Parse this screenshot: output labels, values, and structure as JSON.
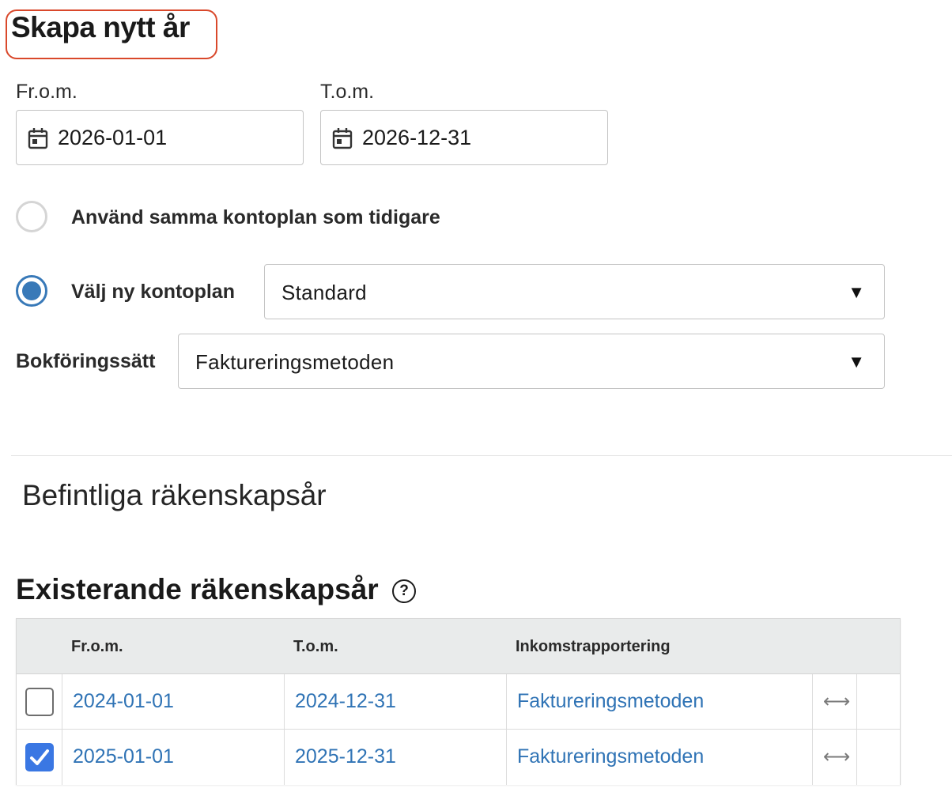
{
  "form": {
    "title": "Skapa nytt år",
    "from_label": "Fr.o.m.",
    "from_value": "2026-01-01",
    "to_label": "T.o.m.",
    "to_value": "2026-12-31",
    "radio_same_label": "Använd samma kontoplan som tidigare",
    "radio_new_label": "Välj ny kontoplan",
    "kontoplan_value": "Standard",
    "bokforing_label": "Bokföringssätt",
    "bokforing_value": "Faktureringsmetoden",
    "dropdown_glyph": "▼"
  },
  "existing": {
    "section_heading": "Befintliga räkenskapsår",
    "heading": "Existerande räkenskapsår",
    "help_glyph": "?",
    "columns": [
      "Fr.o.m.",
      "T.o.m.",
      "Inkomstrapportering"
    ],
    "rows": [
      {
        "checked": false,
        "from": "2024-01-01",
        "to": "2024-12-31",
        "method": "Faktureringsmetoden",
        "action_glyph": "⟷"
      },
      {
        "checked": true,
        "from": "2025-01-01",
        "to": "2025-12-31",
        "method": "Faktureringsmetoden",
        "action_glyph": "⟷"
      }
    ]
  },
  "colors": {
    "accent": "#3879b8",
    "link": "#2f73b5",
    "checkbox_checked": "#3a77e3",
    "title_outline": "#d9482b"
  },
  "icons": {
    "date": "calendar-icon",
    "dropdown": "chevron-down-icon",
    "help": "help-icon",
    "expand": "expand-arrows-icon",
    "check": "checkmark-icon"
  }
}
